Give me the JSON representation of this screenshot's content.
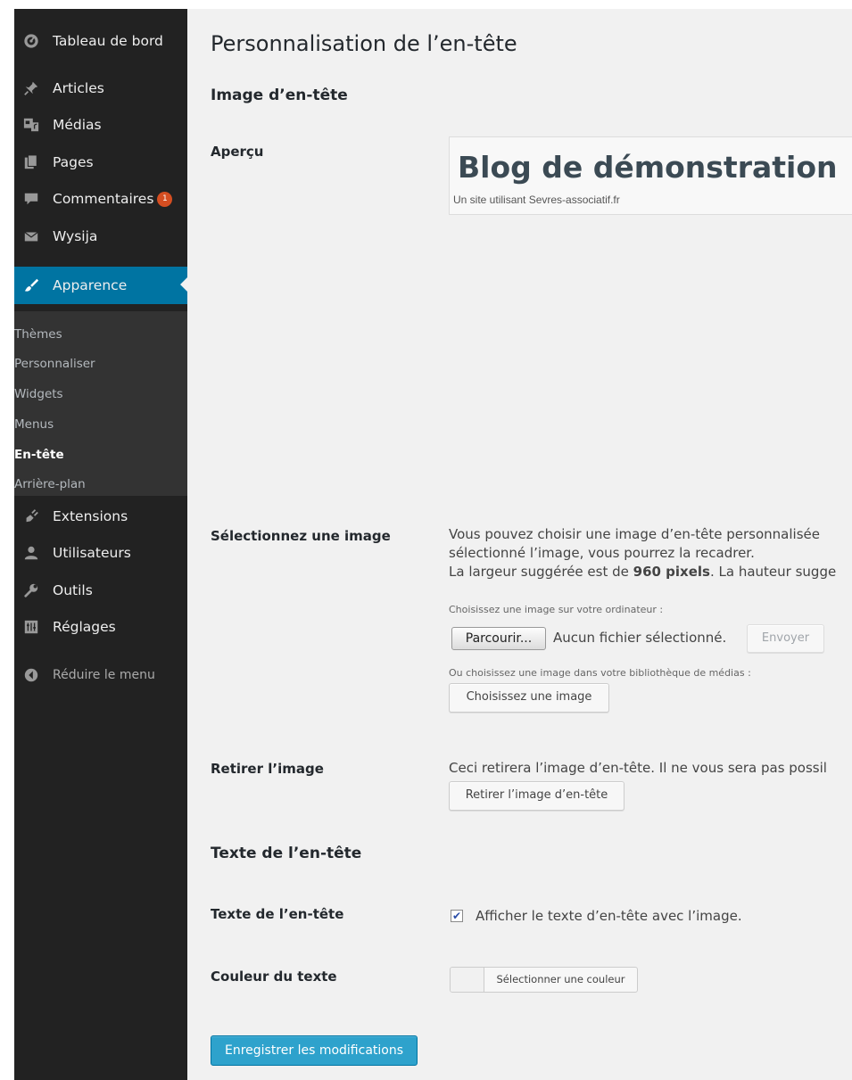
{
  "sidebar": {
    "items": [
      {
        "label": "Tableau de bord",
        "icon": "dashboard-icon"
      },
      {
        "label": "Articles",
        "icon": "pin-icon"
      },
      {
        "label": "Médias",
        "icon": "media-icon"
      },
      {
        "label": "Pages",
        "icon": "pages-icon"
      },
      {
        "label": "Commentaires",
        "icon": "comment-icon",
        "badge": "1"
      },
      {
        "label": "Wysija",
        "icon": "envelope-icon"
      },
      {
        "label": "Apparence",
        "icon": "paintbrush-icon",
        "active": true
      },
      {
        "label": "Extensions",
        "icon": "plugin-icon"
      },
      {
        "label": "Utilisateurs",
        "icon": "user-icon"
      },
      {
        "label": "Outils",
        "icon": "wrench-icon"
      },
      {
        "label": "Réglages",
        "icon": "settings-icon"
      }
    ],
    "submenu": [
      {
        "label": "Thèmes"
      },
      {
        "label": "Personnaliser"
      },
      {
        "label": "Widgets"
      },
      {
        "label": "Menus"
      },
      {
        "label": "En-tête",
        "current": true
      },
      {
        "label": "Arrière-plan"
      }
    ],
    "collapse_label": "Réduire le menu"
  },
  "main": {
    "title": "Personnalisation de l’en-tête",
    "image_section": {
      "title": "Image d’en-tête",
      "preview_label": "Aperçu",
      "preview_site_title": "Blog de démonstration",
      "preview_tagline": "Un site utilisant Sevres-associatif.fr",
      "select_label": "Sélectionnez une image",
      "select_desc_line1": "Vous pouvez choisir une image d’en-tête personnalisée",
      "select_desc_line2": "sélectionné l’image, vous pourrez la recadrer.",
      "select_desc_line3_a": "La largeur suggérée est de ",
      "select_desc_line3_b": "960 pixels",
      "select_desc_line3_c": ". La hauteur sugge",
      "upload_hint": "Choisissez une image sur votre ordinateur :",
      "browse_label": "Parcourir...",
      "no_file": "Aucun fichier sélectionné.",
      "upload_label": "Envoyer",
      "library_hint": "Ou choisissez une image dans votre bibliothèque de médias :",
      "choose_label": "Choisissez une image",
      "remove_label": "Retirer l’image",
      "remove_desc": "Ceci retirera l’image d’en-tête. Il ne vous sera pas possil",
      "remove_button": "Retirer l’image d’en-tête"
    },
    "text_section": {
      "title": "Texte de l’en-tête",
      "header_text_label": "Texte de l’en-tête",
      "show_text_label": "Afficher le texte d’en-tête avec l’image.",
      "show_text_checked": true,
      "color_label": "Couleur du texte",
      "color_button": "Sélectionner une couleur"
    },
    "save_button": "Enregistrer les modifications"
  },
  "colors": {
    "sidebar_bg": "#222222",
    "submenu_bg": "#333333",
    "active_bg": "#0074a2",
    "primary_button": "#2ea2cc",
    "badge": "#d54e21",
    "content_bg": "#f1f1f1"
  }
}
